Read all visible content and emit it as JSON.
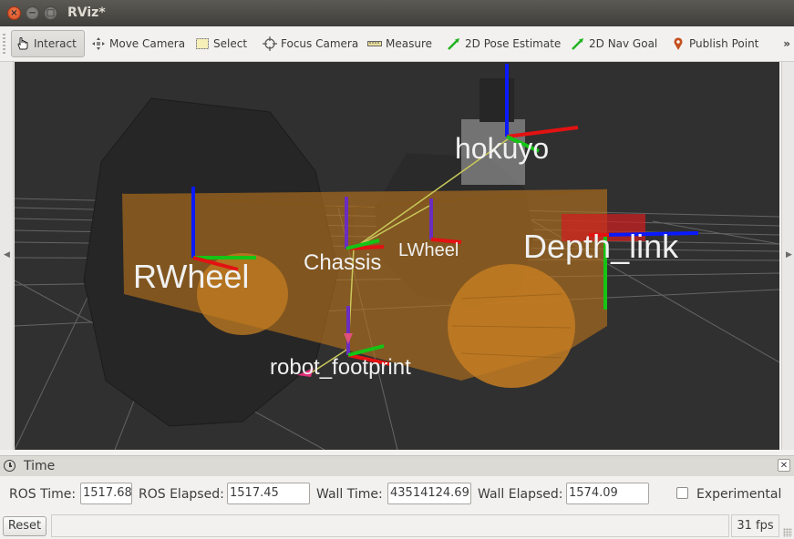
{
  "window": {
    "title": "RViz*"
  },
  "toolbar": {
    "tools": [
      {
        "label": "Interact",
        "icon": "hand-pointer-icon"
      },
      {
        "label": "Move Camera",
        "icon": "move-camera-icon"
      },
      {
        "label": "Select",
        "icon": "select-rect-icon"
      },
      {
        "label": "Focus Camera",
        "icon": "focus-crosshair-icon"
      },
      {
        "label": "Measure",
        "icon": "ruler-icon"
      },
      {
        "label": "2D Pose Estimate",
        "icon": "green-arrow-icon"
      },
      {
        "label": "2D Nav Goal",
        "icon": "green-arrow-icon"
      },
      {
        "label": "Publish Point",
        "icon": "map-pin-icon"
      }
    ],
    "more": "»",
    "active": "Interact"
  },
  "viewport": {
    "frame_labels": [
      "hokuyo",
      "Depth_link",
      "RWheel",
      "Chassis",
      "LWheel",
      "robot_footprint"
    ],
    "colors": {
      "background": "#303030",
      "chassis": "#b8731c",
      "grid": "#7a7a7a",
      "x_axis": "#ff0000",
      "y_axis": "#00cc00",
      "z_axis": "#0000ff"
    }
  },
  "time_panel": {
    "title": "Time",
    "ros_time_label": "ROS Time:",
    "ros_time": "1517.68",
    "ros_elapsed_label": "ROS Elapsed:",
    "ros_elapsed": "1517.45",
    "wall_time_label": "Wall Time:",
    "wall_time": "43514124.69",
    "wall_elapsed_label": "Wall Elapsed:",
    "wall_elapsed": "1574.09",
    "experimental_label": "Experimental"
  },
  "status": {
    "reset_label": "Reset",
    "fps": "31 fps"
  }
}
